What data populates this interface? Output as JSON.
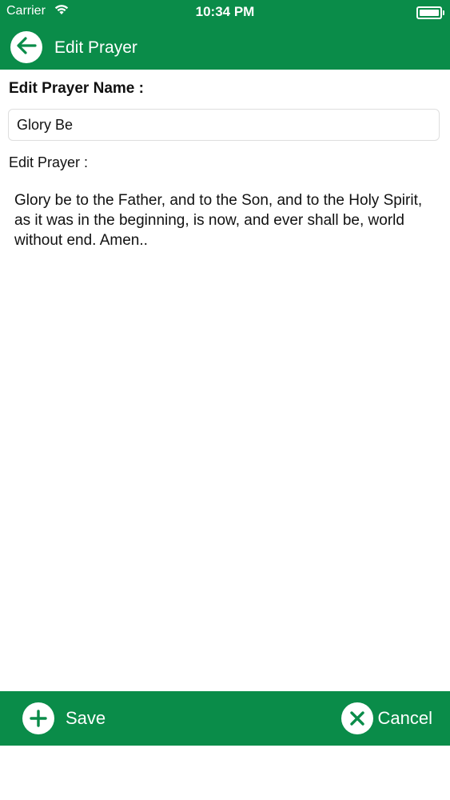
{
  "status_bar": {
    "carrier": "Carrier",
    "time": "10:34 PM"
  },
  "nav": {
    "title": "Edit Prayer"
  },
  "form": {
    "name_label": "Edit Prayer Name :",
    "name_value": "Glory Be",
    "prayer_label": "Edit Prayer :",
    "prayer_text": "Glory be to the Father, and to the Son, and to the Holy Spirit, as it was in the beginning, is now, and ever shall be, world without end. Amen.."
  },
  "toolbar": {
    "save_label": "Save",
    "cancel_label": "Cancel"
  },
  "colors": {
    "brand_green": "#0a8c49",
    "white": "#ffffff"
  },
  "icons": {
    "back": "arrow-left-icon",
    "save": "plus-icon",
    "cancel": "close-icon",
    "wifi": "wifi-icon",
    "battery": "battery-icon"
  }
}
